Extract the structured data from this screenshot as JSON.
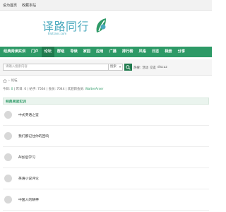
{
  "topbar": {
    "links": [
      "设为首页",
      "收藏本站"
    ]
  },
  "logo": {
    "title": "译路同行",
    "subtitle": "Elotrans.com"
  },
  "nav": {
    "items": [
      "经典阅读实训",
      "门户",
      "论坛",
      "群组",
      "导读",
      "家园",
      "应用",
      "广播",
      "排行榜",
      "风格",
      "日志",
      "相册",
      "分享"
    ],
    "active_index": 2
  },
  "search": {
    "placeholder": "请输入搜索内容",
    "type_label": "搜索",
    "hot_label": "热搜:",
    "hot_links": [
      "活动",
      "交友",
      "discuz"
    ]
  },
  "breadcrumb": {
    "sep": "›",
    "current": "论坛"
  },
  "stats": {
    "today_label": "今日:",
    "today": "0",
    "yesterday_label": "昨日:",
    "yesterday": "0",
    "posts_label": "帖子:",
    "posts": "7564",
    "members_label": "会员:",
    "members": "7044",
    "newest_label": "欢迎新会员:",
    "newest": "WalterArser"
  },
  "section": {
    "title": "经典阅读实训"
  },
  "forums": [
    {
      "title": "中式英语之鉴"
    },
    {
      "title": "我们都记住你的回响"
    },
    {
      "title": "AI加后学习"
    },
    {
      "title": "英语小说评论"
    },
    {
      "title": "中国人的精神"
    }
  ],
  "colors": {
    "nav": "#2e9a67",
    "nav_active": "#1f7a4d",
    "logo": "#4aa9bd"
  }
}
